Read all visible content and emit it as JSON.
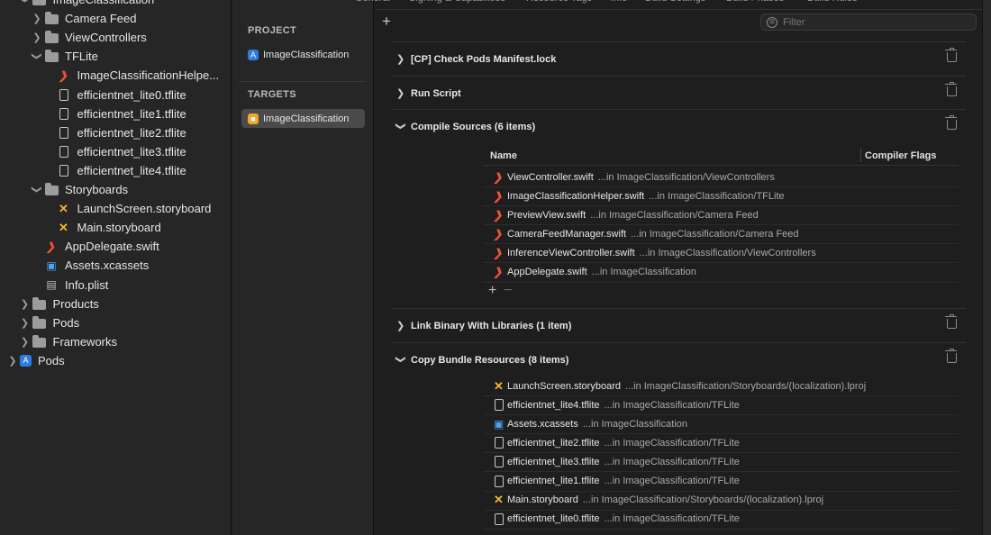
{
  "navigator": {
    "items": [
      {
        "label": "ImageClassification",
        "icon": "folder-icon",
        "chevron": "expanded",
        "indent": 1
      },
      {
        "label": "Camera Feed",
        "icon": "folder-icon",
        "chevron": "collapsed",
        "indent": 2
      },
      {
        "label": "ViewControllers",
        "icon": "folder-icon",
        "chevron": "collapsed",
        "indent": 2
      },
      {
        "label": "TFLite",
        "icon": "folder-icon",
        "chevron": "expanded",
        "indent": 2
      },
      {
        "label": "ImageClassificationHelpe...",
        "icon": "swift-file-icon",
        "chevron": "none",
        "indent": 3
      },
      {
        "label": "efficientnet_lite0.tflite",
        "icon": "document-icon",
        "chevron": "none",
        "indent": 3
      },
      {
        "label": "efficientnet_lite1.tflite",
        "icon": "document-icon",
        "chevron": "none",
        "indent": 3
      },
      {
        "label": "efficientnet_lite2.tflite",
        "icon": "document-icon",
        "chevron": "none",
        "indent": 3
      },
      {
        "label": "efficientnet_lite3.tflite",
        "icon": "document-icon",
        "chevron": "none",
        "indent": 3
      },
      {
        "label": "efficientnet_lite4.tflite",
        "icon": "document-icon",
        "chevron": "none",
        "indent": 3
      },
      {
        "label": "Storyboards",
        "icon": "folder-icon",
        "chevron": "expanded",
        "indent": 2
      },
      {
        "label": "LaunchScreen.storyboard",
        "icon": "storyboard-icon",
        "chevron": "none",
        "indent": 3
      },
      {
        "label": "Main.storyboard",
        "icon": "storyboard-icon",
        "chevron": "none",
        "indent": 3
      },
      {
        "label": "AppDelegate.swift",
        "icon": "swift-file-icon",
        "chevron": "none",
        "indent": 2
      },
      {
        "label": "Assets.xcassets",
        "icon": "asset-catalog-icon",
        "chevron": "none",
        "indent": 2
      },
      {
        "label": "Info.plist",
        "icon": "plist-icon",
        "chevron": "none",
        "indent": 2
      },
      {
        "label": "Products",
        "icon": "folder-icon",
        "chevron": "collapsed",
        "indent": 1
      },
      {
        "label": "Pods",
        "icon": "folder-icon",
        "chevron": "collapsed",
        "indent": 1
      },
      {
        "label": "Frameworks",
        "icon": "folder-icon",
        "chevron": "collapsed",
        "indent": 1
      },
      {
        "label": "Pods",
        "icon": "xcode-project-icon",
        "chevron": "collapsed",
        "indent": 0
      }
    ]
  },
  "project_column": {
    "project_title": "PROJECT",
    "project_item": "ImageClassification",
    "targets_title": "TARGETS",
    "target_item": "ImageClassification"
  },
  "tabs": [
    "General",
    "Signing & Capabilities",
    "Resource Tags",
    "Info",
    "Build Settings",
    "Build Phases",
    "Build Rules"
  ],
  "filter_placeholder": "Filter",
  "phases": {
    "check_pods": "[CP] Check Pods Manifest.lock",
    "run_script": "Run Script",
    "compile_sources": "Compile Sources (6 items)",
    "link_binary": "Link Binary With Libraries (1 item)",
    "copy_bundle": "Copy Bundle Resources (8 items)"
  },
  "compile_table": {
    "col_name": "Name",
    "col_flags": "Compiler Flags",
    "rows": [
      {
        "name": "ViewController.swift",
        "path": "...in ImageClassification/ViewControllers",
        "icon": "swift-file-icon"
      },
      {
        "name": "ImageClassificationHelper.swift",
        "path": "...in ImageClassification/TFLite",
        "icon": "swift-file-icon"
      },
      {
        "name": "PreviewView.swift",
        "path": "...in ImageClassification/Camera Feed",
        "icon": "swift-file-icon"
      },
      {
        "name": "CameraFeedManager.swift",
        "path": "...in ImageClassification/Camera Feed",
        "icon": "swift-file-icon"
      },
      {
        "name": "InferenceViewController.swift",
        "path": "...in ImageClassification/ViewControllers",
        "icon": "swift-file-icon"
      },
      {
        "name": "AppDelegate.swift",
        "path": "...in ImageClassification",
        "icon": "swift-file-icon"
      }
    ]
  },
  "copy_rows": [
    {
      "name": "LaunchScreen.storyboard",
      "path": "...in ImageClassification/Storyboards/(localization).lproj",
      "icon": "storyboard-icon"
    },
    {
      "name": "efficientnet_lite4.tflite",
      "path": "...in ImageClassification/TFLite",
      "icon": "document-icon"
    },
    {
      "name": "Assets.xcassets",
      "path": "...in ImageClassification",
      "icon": "asset-catalog-icon"
    },
    {
      "name": "efficientnet_lite2.tflite",
      "path": "...in ImageClassification/TFLite",
      "icon": "document-icon"
    },
    {
      "name": "efficientnet_lite3.tflite",
      "path": "...in ImageClassification/TFLite",
      "icon": "document-icon"
    },
    {
      "name": "efficientnet_lite1.tflite",
      "path": "...in ImageClassification/TFLite",
      "icon": "document-icon"
    },
    {
      "name": "Main.storyboard",
      "path": "...in ImageClassification/Storyboards/(localization).lproj",
      "icon": "storyboard-icon"
    },
    {
      "name": "efficientnet_lite0.tflite",
      "path": "...in ImageClassification/TFLite",
      "icon": "document-icon"
    }
  ],
  "colors": {
    "swift": "#f05138",
    "storyboard": "#f2b52c",
    "assets": "#4ea3f0",
    "selection": "#4a4a4a"
  }
}
